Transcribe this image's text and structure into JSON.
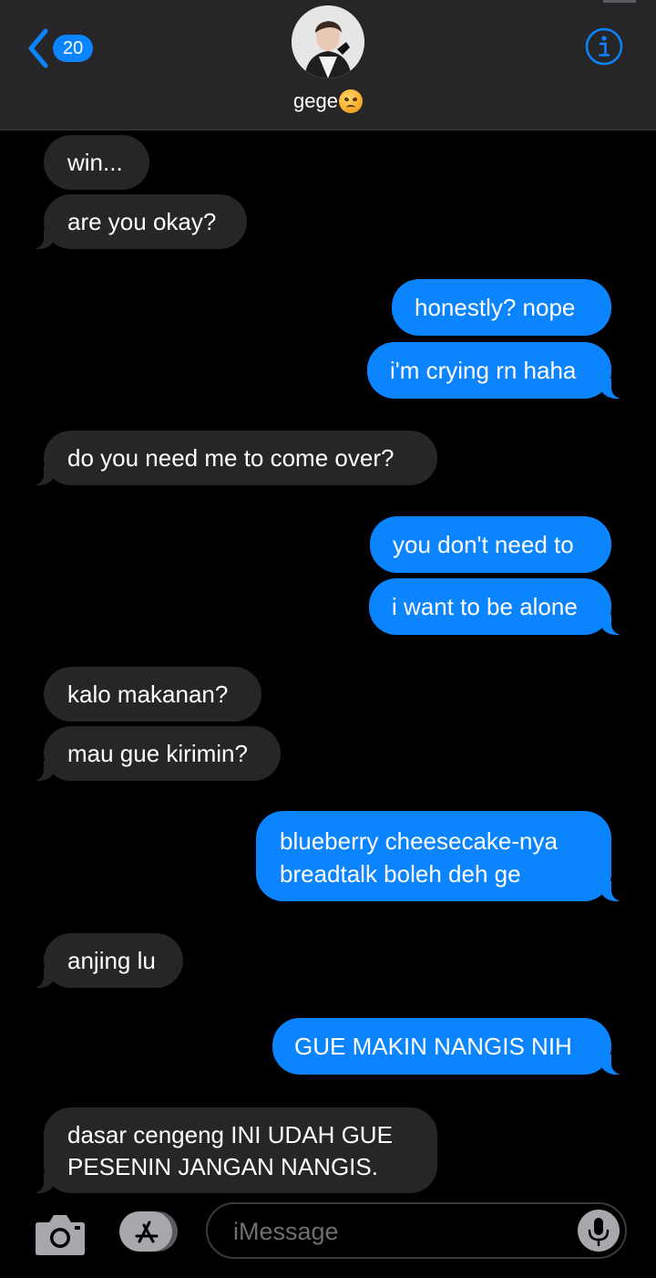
{
  "header": {
    "back_count": "20",
    "contact_name": "gege",
    "contact_emoji": "angry-face",
    "icons": {
      "back": "chevron-left-icon",
      "info": "info-icon"
    }
  },
  "messages": [
    {
      "direction": "received",
      "lines": [
        "win..."
      ]
    },
    {
      "direction": "received",
      "lines": [
        "are you okay?"
      ]
    },
    {
      "direction": "sent",
      "lines": [
        "honestly? nope"
      ]
    },
    {
      "direction": "sent",
      "lines": [
        "i'm crying rn haha"
      ]
    },
    {
      "direction": "received",
      "lines": [
        "do you need me to come over?"
      ]
    },
    {
      "direction": "sent",
      "lines": [
        "you don't need to"
      ]
    },
    {
      "direction": "sent",
      "lines": [
        "i want to be alone"
      ]
    },
    {
      "direction": "received",
      "lines": [
        "kalo makanan?"
      ]
    },
    {
      "direction": "received",
      "lines": [
        "mau gue kirimin?"
      ]
    },
    {
      "direction": "sent",
      "lines": [
        "blueberry cheesecake-nya",
        "breadtalk boleh deh ge"
      ]
    },
    {
      "direction": "received",
      "lines": [
        "anjing lu"
      ]
    },
    {
      "direction": "sent",
      "lines": [
        "GUE MAKIN NANGIS NIH"
      ]
    },
    {
      "direction": "received",
      "lines": [
        "dasar cengeng INI UDAH GUE",
        "PESENIN JANGAN NANGIS."
      ]
    }
  ],
  "input": {
    "placeholder": "iMessage",
    "icons": {
      "camera": "camera-icon",
      "apps": "app-store-icon",
      "mic": "microphone-icon"
    }
  },
  "colors": {
    "sent_bubble": "#0a84ff",
    "received_bubble": "#262629",
    "header_bg": "#262628",
    "background": "#000000"
  }
}
